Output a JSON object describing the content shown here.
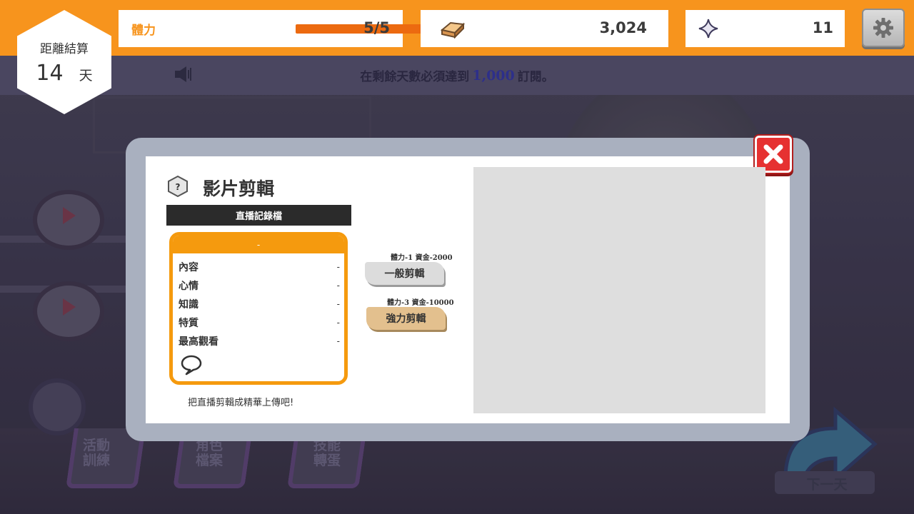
{
  "hud": {
    "countdown": {
      "label": "距離結算",
      "days": "14",
      "unit": "天"
    },
    "stamina": {
      "label": "體力",
      "value": "5/5",
      "fill_fraction": 1.0,
      "icon": "stamina-bar"
    },
    "gold": {
      "value": "3,024",
      "icon": "gold-ingot-icon"
    },
    "gems": {
      "value": "11",
      "icon": "sparkle-star-icon"
    },
    "settings": {
      "icon": "gear-icon"
    }
  },
  "notice": {
    "before": "在剩餘天數必須達到",
    "number": "1,000",
    "after": "訂閱。"
  },
  "bottom_tabs": [
    {
      "label": "活動\n訓練"
    },
    {
      "label": "角色\n檔案"
    },
    {
      "label": "技能\n轉蛋"
    }
  ],
  "next_day": {
    "label": "下一天"
  },
  "modal": {
    "title": "影片剪輯",
    "record_label": "直播記錄檔",
    "card": {
      "header": "-",
      "rows": [
        {
          "label": "內容",
          "value": "-"
        },
        {
          "label": "心情",
          "value": "-"
        },
        {
          "label": "知識",
          "value": "-"
        },
        {
          "label": "特質",
          "value": "-"
        },
        {
          "label": "最高觀看",
          "value": "-"
        }
      ]
    },
    "caption": "把直播剪輯成精華上傳吧!",
    "options": [
      {
        "cost": "體力-1 資金-2000",
        "label": "一般剪輯"
      },
      {
        "cost": "體力-3 資金-10000",
        "label": "強力剪輯"
      }
    ]
  },
  "colors": {
    "topbar": "#f7941d",
    "stamina_fill": "#ec6a10",
    "card_border": "#f59a0e",
    "close": "#e63131",
    "notice_number": "#2d2f8a"
  }
}
